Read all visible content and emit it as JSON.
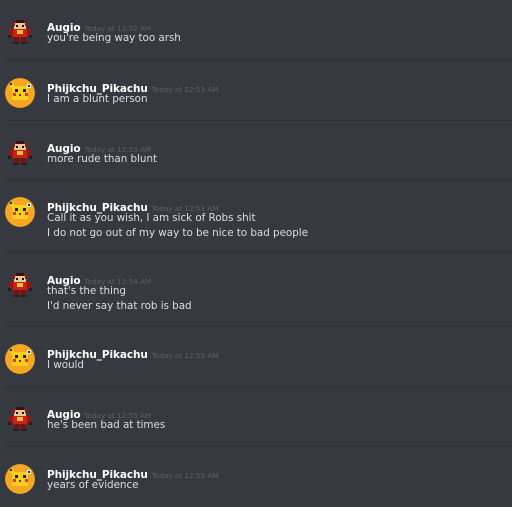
{
  "colors": {
    "background": "#36393f",
    "divider": "#2f3136",
    "author": "#ffffff",
    "timestamp": "#5b6068",
    "message_text": "#dcddde",
    "pikachu_avatar_bg": "#f5a623"
  },
  "messages": [
    {
      "author": "Augio",
      "avatar_icon": "red-robot-avatar-icon",
      "timestamp": "Today at 12:52 AM",
      "lines": [
        "you're being way too arsh"
      ]
    },
    {
      "author": "Phijkchu_Pikachu",
      "avatar_icon": "pikachu-avatar-icon",
      "timestamp": "Today at 12:53 AM",
      "lines": [
        "I am a blunt person"
      ]
    },
    {
      "author": "Augio",
      "avatar_icon": "red-robot-avatar-icon",
      "timestamp": "Today at 12:53 AM",
      "lines": [
        "more rude than blunt"
      ]
    },
    {
      "author": "Phijkchu_Pikachu",
      "avatar_icon": "pikachu-avatar-icon",
      "timestamp": "Today at 12:53 AM",
      "lines": [
        "Call it as you wish, I am sick of Robs shit",
        "I do not go out of my way to be nice to bad people"
      ]
    },
    {
      "author": "Augio",
      "avatar_icon": "red-robot-avatar-icon",
      "timestamp": "Today at 12:54 AM",
      "lines": [
        "that's the thing",
        "I'd never say that rob is bad"
      ]
    },
    {
      "author": "Phijkchu_Pikachu",
      "avatar_icon": "pikachu-avatar-icon",
      "timestamp": "Today at 12:55 AM",
      "lines": [
        "I would"
      ]
    },
    {
      "author": "Augio",
      "avatar_icon": "red-robot-avatar-icon",
      "timestamp": "Today at 12:55 AM",
      "lines": [
        "he's been bad at times"
      ]
    },
    {
      "author": "Phijkchu_Pikachu",
      "avatar_icon": "pikachu-avatar-icon",
      "timestamp": "Today at 12:55 AM",
      "lines": [
        "years of evidence"
      ]
    }
  ]
}
